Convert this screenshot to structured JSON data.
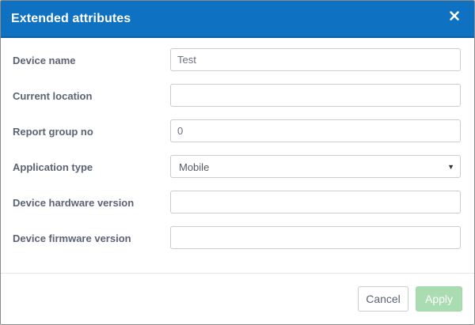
{
  "dialog": {
    "title": "Extended attributes",
    "close_icon": "close-icon"
  },
  "form": {
    "device_name": {
      "label": "Device name",
      "value": "Test"
    },
    "current_location": {
      "label": "Current location",
      "value": ""
    },
    "report_group_no": {
      "label": "Report group no",
      "value": "0"
    },
    "application_type": {
      "label": "Application type",
      "value": "Mobile",
      "caret": "▼"
    },
    "device_hardware_version": {
      "label": "Device hardware version",
      "value": ""
    },
    "device_firmware_version": {
      "label": "Device firmware version",
      "value": ""
    }
  },
  "footer": {
    "cancel_label": "Cancel",
    "apply_label": "Apply"
  },
  "colors": {
    "header": "#0e71c2",
    "label_text": "#5a6474",
    "apply_disabled": "#a9dcb0"
  }
}
